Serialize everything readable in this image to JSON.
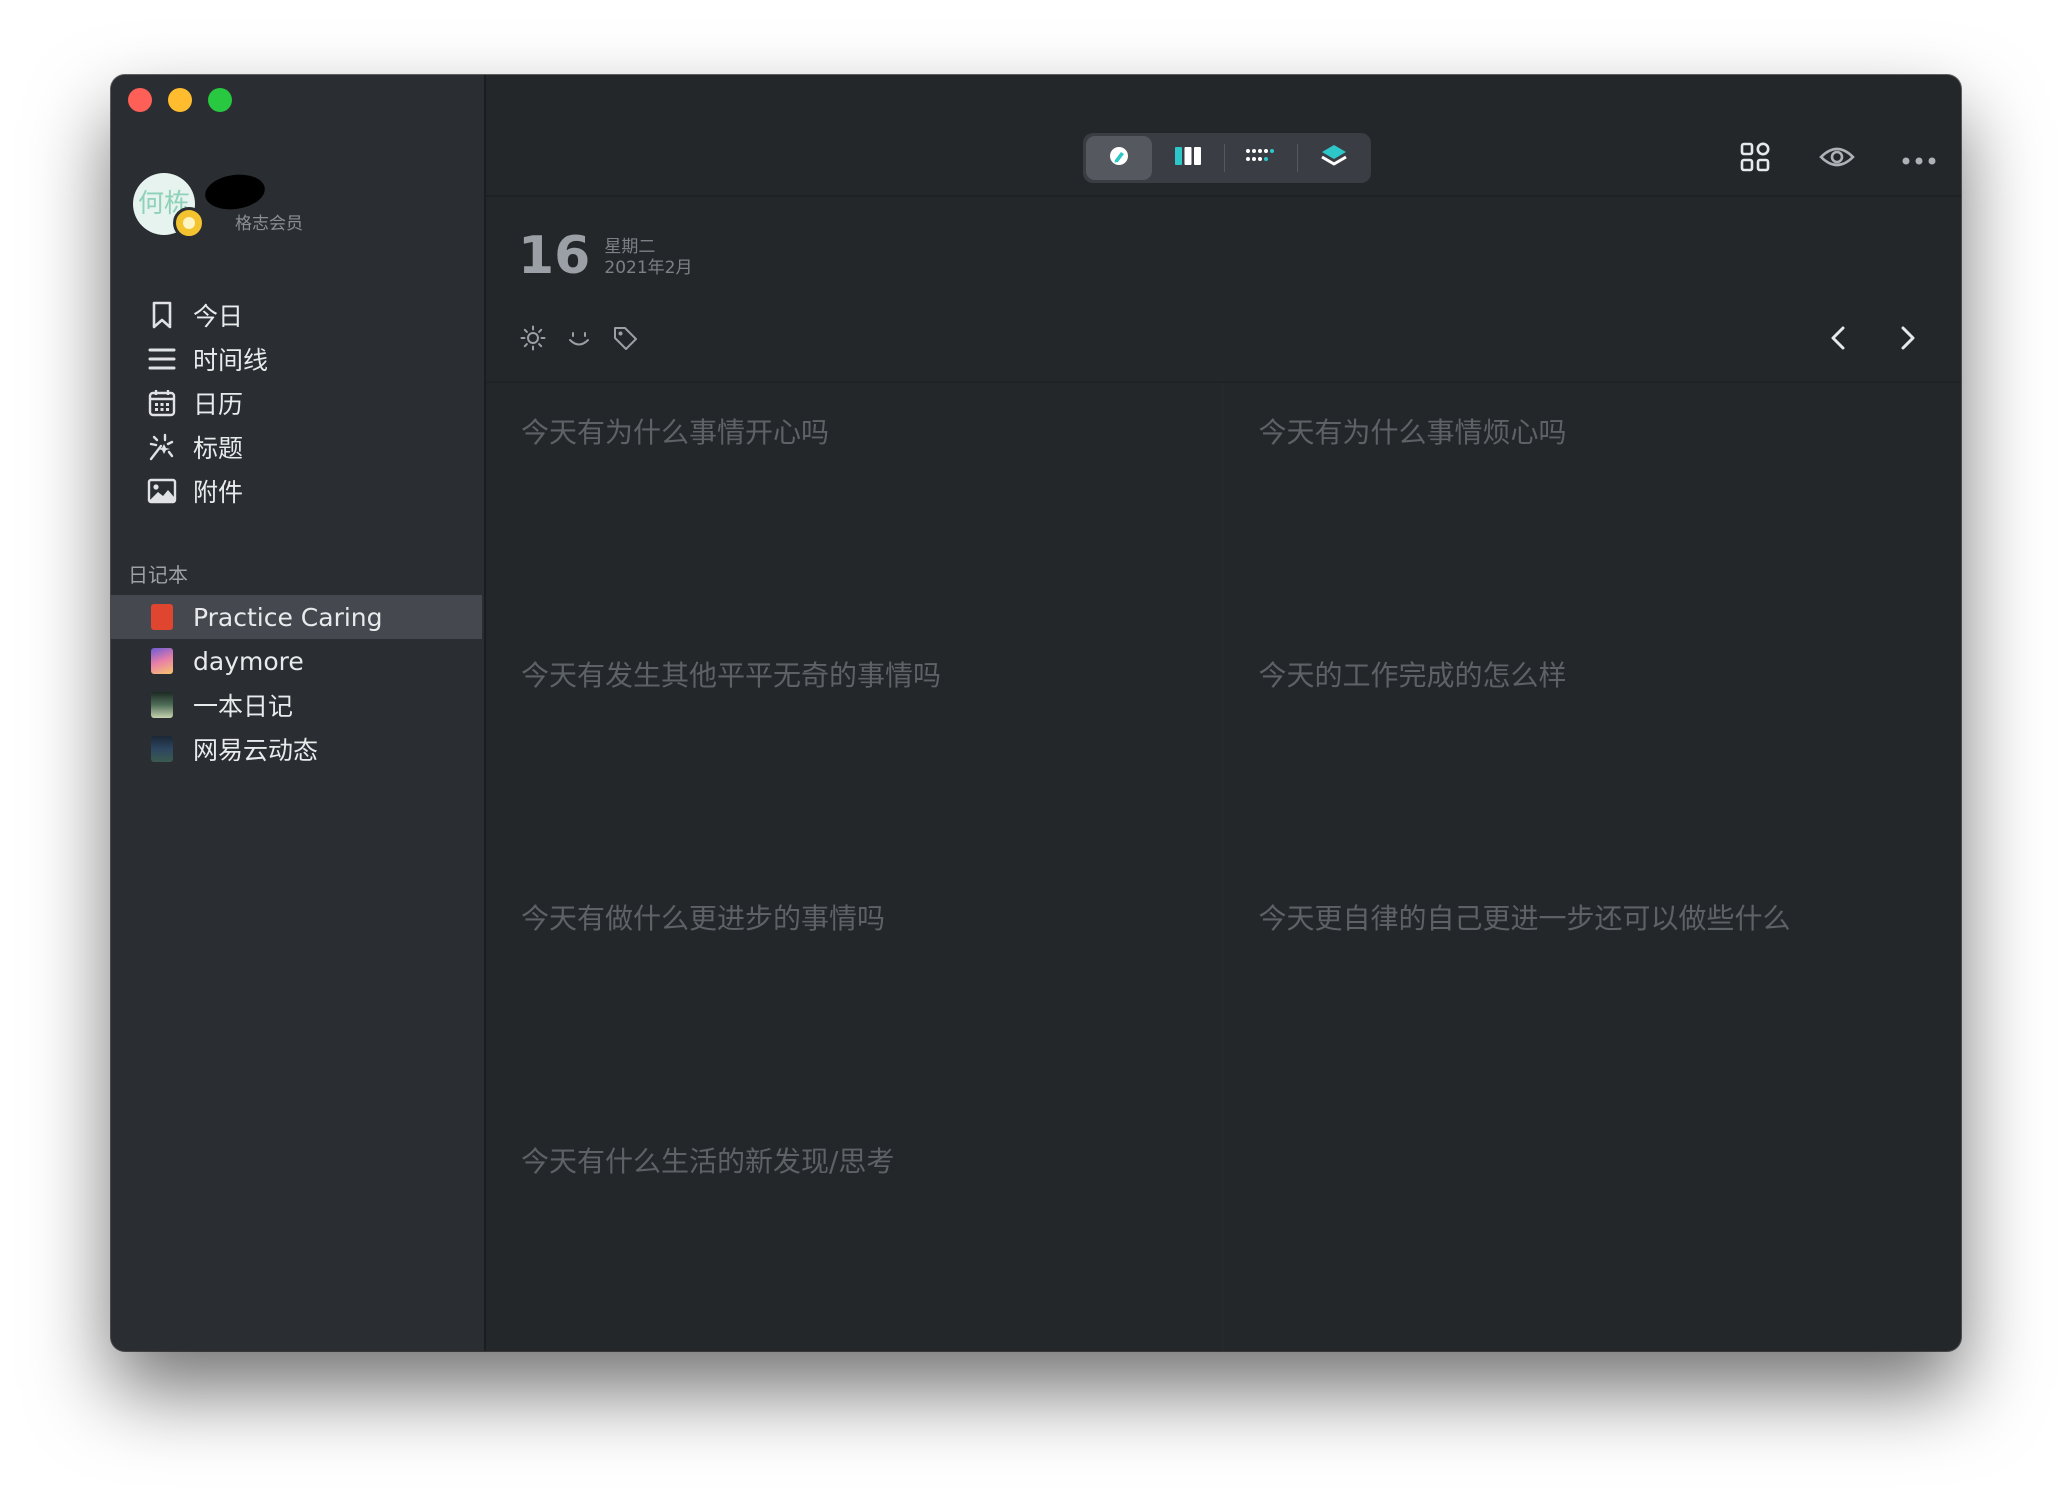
{
  "window": {
    "traffic_lights": {
      "close": "#fe5f57",
      "minimize": "#febc2e",
      "maximize": "#28c840"
    }
  },
  "profile": {
    "avatar_text": "何栋",
    "membership": "格志会员"
  },
  "nav": {
    "items": [
      {
        "label": "今日",
        "icon": "bookmark-icon"
      },
      {
        "label": "时间线",
        "icon": "list-icon"
      },
      {
        "label": "日历",
        "icon": "calendar-icon"
      },
      {
        "label": "标题",
        "icon": "sparkle-icon"
      },
      {
        "label": "附件",
        "icon": "image-icon"
      }
    ]
  },
  "notebooks": {
    "section_label": "日记本",
    "items": [
      {
        "label": "Practice Caring",
        "selected": true,
        "thumb_color": "#e0452f"
      },
      {
        "label": "daymore",
        "selected": false,
        "thumb_color": "#b76ad8"
      },
      {
        "label": "一本日记",
        "selected": false,
        "thumb_color": "#3d5a4a"
      },
      {
        "label": "网易云动态",
        "selected": false,
        "thumb_color": "#2d3d52"
      }
    ]
  },
  "toolbar": {
    "view_modes": [
      "edit-icon",
      "columns-icon",
      "dots-icon",
      "layers-icon"
    ],
    "active_mode": "edit-icon",
    "right_icons": [
      "grid-icon",
      "eye-icon",
      "more-icon"
    ],
    "accent_color": "#2ec7c9"
  },
  "date": {
    "day": "16",
    "weekday": "星期二",
    "year_month": "2021年2月"
  },
  "entry_tools": [
    "sun-icon",
    "mood-icon",
    "tag-icon"
  ],
  "prompts": [
    "今天有为什么事情开心吗",
    "今天有为什么事情烦心吗",
    "今天有发生其他平平无奇的事情吗",
    "今天的工作完成的怎么样",
    "今天有做什么更进步的事情吗",
    "今天更自律的自己更进一步还可以做些什么",
    "今天有什么生活的新发现/思考"
  ]
}
